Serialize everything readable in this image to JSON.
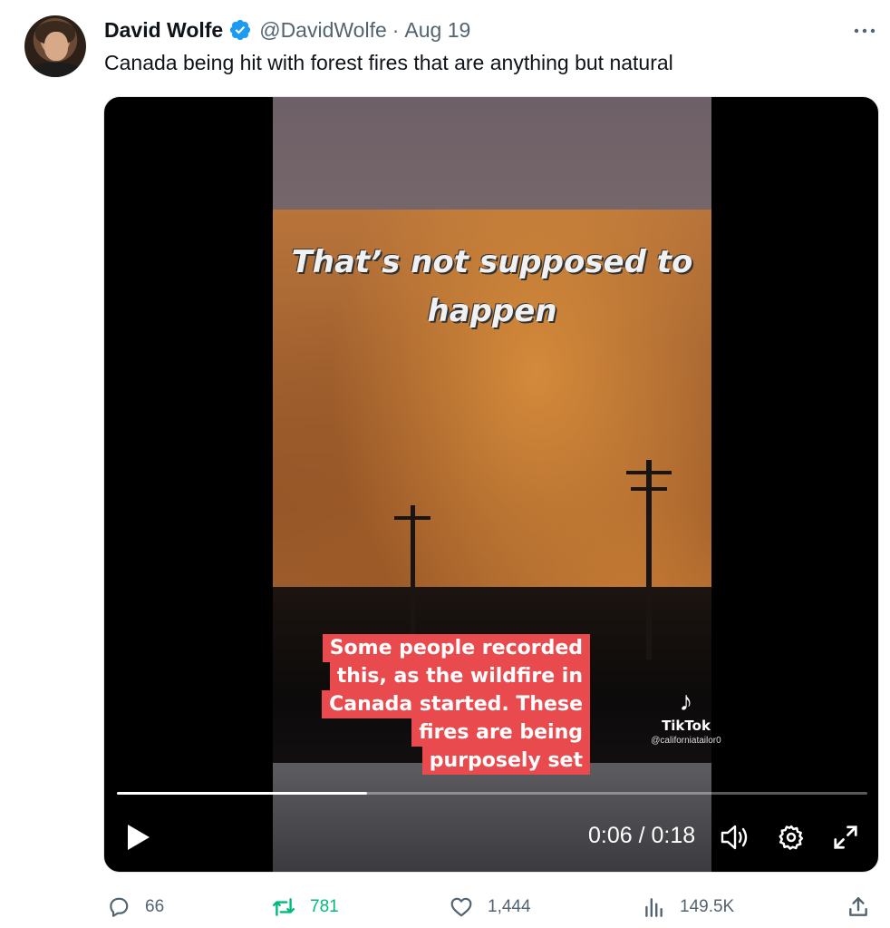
{
  "author": {
    "name": "David Wolfe",
    "handle": "@DavidWolfe",
    "separator": "·",
    "date": "Aug 19",
    "verified": true
  },
  "tweet_text": "Canada being hit with forest fires that are anything but natural",
  "video": {
    "overlay_top": "That’s not supposed to\nhappen",
    "overlay_caption": [
      "Some people recorded",
      "this, as the wildfire in",
      "Canada started. These",
      "fires are being",
      "purposely set"
    ],
    "watermark_brand": "TikTok",
    "watermark_user": "@californiatailor0",
    "time": "0:06 / 0:18",
    "progress": 0.333
  },
  "actions": {
    "replies": "66",
    "retweets": "781",
    "likes": "1,444",
    "views": "149.5K"
  },
  "colors": {
    "verified": "#1d9bf0",
    "retweet_active": "#00ba7c",
    "secondary_text": "#536471",
    "caption_bg": "#e94a4e"
  },
  "icons": [
    "more-icon",
    "verified-badge-icon",
    "play-icon",
    "volume-icon",
    "settings-icon",
    "fullscreen-icon",
    "reply-icon",
    "retweet-icon",
    "like-icon",
    "views-icon",
    "share-icon"
  ]
}
